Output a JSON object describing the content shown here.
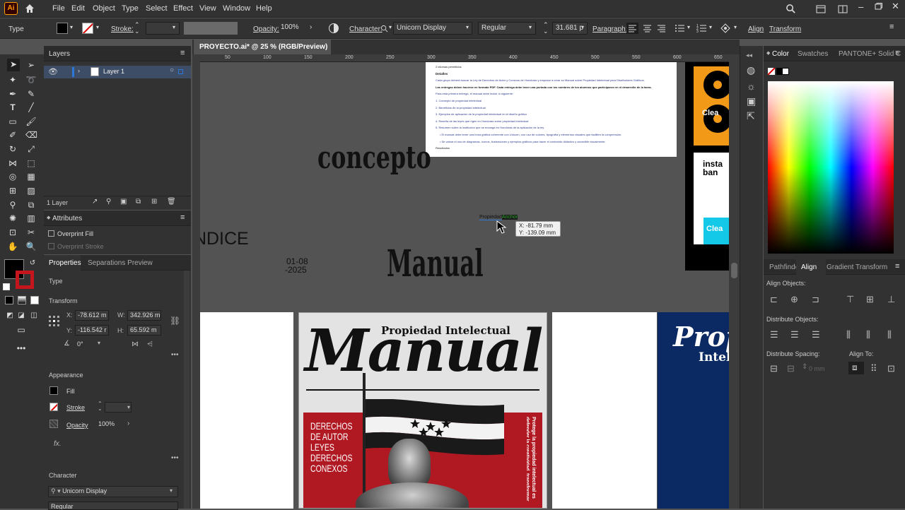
{
  "menu": [
    "File",
    "Edit",
    "Object",
    "Type",
    "Select",
    "Effect",
    "View",
    "Window",
    "Help"
  ],
  "logo": "Ai",
  "control": {
    "selection_label": "Type",
    "stroke_label": "Stroke:",
    "opacity_label": "Opacity:",
    "opacity_value": "100%",
    "character_label": "Character:",
    "font_name": "Unicorn Display",
    "font_style": "Regular",
    "font_size": "31.681 p",
    "paragraph_label": "Paragraph:",
    "align_label": "Align",
    "transform_label": "Transform"
  },
  "document": {
    "tab_title": "PROYECTO.ai* @ 25 % (RGB/Preview)",
    "close": "×"
  },
  "ruler": [
    "50",
    "100",
    "150",
    "200",
    "250",
    "300",
    "350",
    "400",
    "450",
    "500",
    "550",
    "600",
    "650"
  ],
  "layers_panel": {
    "tab": "Layers",
    "layer_name": "Layer 1",
    "footer": "1 Layer"
  },
  "attributes_panel": {
    "tab": "Attributes",
    "overprint_fill": "Overprint Fill",
    "overprint_stroke": "Overprint Stroke"
  },
  "properties_panel": {
    "tab1": "Properties",
    "tab2": "Separations Preview",
    "section_type": "Type",
    "transform_title": "Transform",
    "x_label": "X:",
    "x_value": "-78.612 m",
    "y_label": "Y:",
    "y_value": "-116.542 r",
    "w_label": "W:",
    "w_value": "342.926 m",
    "h_label": "H:",
    "h_value": "65.592 m",
    "angle": "0°",
    "appearance_title": "Appearance",
    "fill_label": "Fill",
    "stroke_label": "Stroke",
    "opacity_label": "Opacity",
    "opacity_value": "100%",
    "character_title": "Character",
    "font": "Unicorn Display",
    "style": "Regular"
  },
  "canvas": {
    "concepto": "concepto",
    "indice": "ÍNDICE",
    "date1": "01-08",
    "date2": "-2025",
    "manual_word": "Manual",
    "cursor_text_a": "Propiedad",
    "cursor_text_b": "Anchor",
    "tooltip_x": "X: -81.79 mm",
    "tooltip_y": "Y: -139.09 mm",
    "doc_lines": [
      "2 idiomas permitidos",
      "Detalles",
      "Cada grupo deberá buscar la Ley de Derechos de Autor y Conexos de Honduras y empezar a crear su Manual sobre Propiedad Intelectual para Diseñadores Gráficos.",
      "Las entregas deben hacerse en formato PDF. Cada entrega debe tener una portada con los nombres de los alumnos que participaron en el desarrollo de la tarea.",
      "Para esta primera entrega, el manual debe incluir lo siguiente:",
      "1. Concepto de propiedad intelectual",
      "2. Beneficios de la propiedad intelectual",
      "3. Ejemplos de aplicación de la propiedad intelectual en el diseño gráfico",
      "4. Reseña de las leyes que rigen en Honduras sobre propiedad intelectual",
      "5. Resumen sobre la institución que se encarga en Honduras de la aplicación de la ley",
      "• El manual debe tener una línea gráfica coherente con Unicorn, con uso de colores, tipografía y elementos visuales que faciliten la comprensión.",
      "• Se valora el uso de diagramas, íconos, ilustraciones y ejemplos gráficos para hacer el contenido didáctico y accesible visualmente.",
      "Resultados"
    ],
    "cover_subtitle": "Propiedad Intelectual",
    "cover_title": "Manual",
    "red_lines": [
      "DERECHOS",
      "DE AUTOR",
      "LEYES",
      "DERECHOS",
      "CONEXOS"
    ],
    "red_side": "Protege la propiedad intelectual es defender la creatividad, transformar ideas en motores de desarrollo",
    "blue_title": "Prop",
    "blue_sub": "Intel",
    "yellow_text": "Clea",
    "white_text_a": "insta",
    "white_text_b": "ban",
    "cyan_text": "Clea"
  },
  "color_panel": {
    "tabs": [
      "Color",
      "Swatches",
      "PANTONE+ Solid C"
    ]
  },
  "align_panel": {
    "tabs": [
      "Pathfinde",
      "Align",
      "Gradient",
      "Transform"
    ],
    "align_objects": "Align Objects:",
    "distribute_objects": "Distribute Objects:",
    "distribute_spacing": "Distribute Spacing:",
    "spacing_value": "0 mm",
    "align_to": "Align To:"
  },
  "colors": {
    "flag_blue": "#1f3c8c",
    "red": "#b01822",
    "navy": "#0b2a63",
    "orange": "#f29a18",
    "cyan": "#14c8e8",
    "accent_blue": "#2d78d7"
  }
}
